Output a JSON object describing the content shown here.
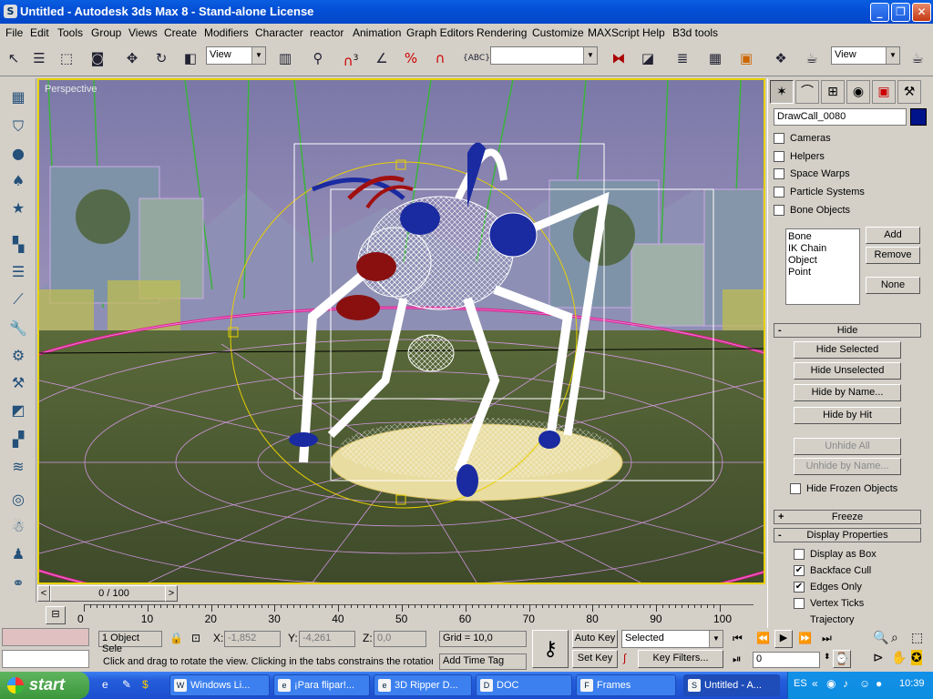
{
  "window": {
    "title": "Untitled - Autodesk 3ds Max 8  - Stand-alone License",
    "app_icon": "S",
    "minimize": "_",
    "restore": "❐",
    "close": "✕"
  },
  "menu": [
    "File",
    "Edit",
    "Tools",
    "Group",
    "Views",
    "Create",
    "Modifiers",
    "Character",
    "reactor",
    "Animation",
    "Graph Editors",
    "Rendering",
    "Customize",
    "MAXScript",
    "Help",
    "B3d tools"
  ],
  "toolbar": {
    "ref_coord": "View",
    "named_selection": "",
    "view2": "View",
    "snap_label": "3",
    "abc_label": "ABC"
  },
  "viewport": {
    "label": "Perspective"
  },
  "command_panel": {
    "object_name": "DrawCall_0080",
    "object_color": "#00138a",
    "filters": [
      {
        "label": "Cameras",
        "checked": false
      },
      {
        "label": "Helpers",
        "checked": false
      },
      {
        "label": "Space Warps",
        "checked": false
      },
      {
        "label": "Particle Systems",
        "checked": false
      },
      {
        "label": "Bone Objects",
        "checked": false
      }
    ],
    "list_items": [
      "Bone",
      "IK Chain Object",
      "Point"
    ],
    "add_label": "Add",
    "remove_label": "Remove",
    "none_label": "None",
    "hide_rollout": {
      "sign": "-",
      "title": "Hide"
    },
    "hide_selected": "Hide Selected",
    "hide_unselected": "Hide Unselected",
    "hide_by_name": "Hide by Name...",
    "hide_by_hit": "Hide by Hit",
    "unhide_all": "Unhide All",
    "unhide_by_name": "Unhide by Name...",
    "hide_frozen": {
      "label": "Hide Frozen Objects",
      "checked": false
    },
    "freeze_rollout": {
      "sign": "+",
      "title": "Freeze"
    },
    "display_rollout": {
      "sign": "-",
      "title": "Display Properties"
    },
    "display_checks": [
      {
        "label": "Display as Box",
        "checked": false
      },
      {
        "label": "Backface Cull",
        "checked": true
      },
      {
        "label": "Edges Only",
        "checked": true
      },
      {
        "label": "Vertex Ticks",
        "checked": false
      },
      {
        "label": "Trajectory",
        "checked": false
      }
    ],
    "check_mark": "✔"
  },
  "time_slider": {
    "value": "0 / 100",
    "prev": "<",
    "next": ">"
  },
  "track_ticks": [
    "0",
    "10",
    "20",
    "30",
    "40",
    "50",
    "60",
    "70",
    "80",
    "90",
    "100"
  ],
  "status": {
    "objects_selected": "1 Object Sele",
    "x_label": "X:",
    "x_value": "-1,852",
    "y_label": "Y:",
    "y_value": "-4,261",
    "z_label": "Z:",
    "z_value": "0,0",
    "grid": "Grid = 10,0",
    "prompt": "Click and drag to rotate the view.  Clicking in the tabs constrains the rotation",
    "add_time_tag": "Add Time Tag",
    "auto_key": "Auto Key",
    "set_key": "Set Key",
    "key_mode": "Selected",
    "key_filters": "Key Filters...",
    "frame": "0"
  },
  "taskbar": {
    "start": "start",
    "tasks": [
      {
        "label": "Windows Li...",
        "icon": "W"
      },
      {
        "label": "¡Para flipar!...",
        "icon": "e"
      },
      {
        "label": "3D Ripper D...",
        "icon": "e"
      },
      {
        "label": "DOC",
        "icon": "D"
      },
      {
        "label": "Frames",
        "icon": "F"
      },
      {
        "label": "Untitled - A...",
        "icon": "S"
      }
    ],
    "lang": "ES",
    "clock": "10:39"
  }
}
